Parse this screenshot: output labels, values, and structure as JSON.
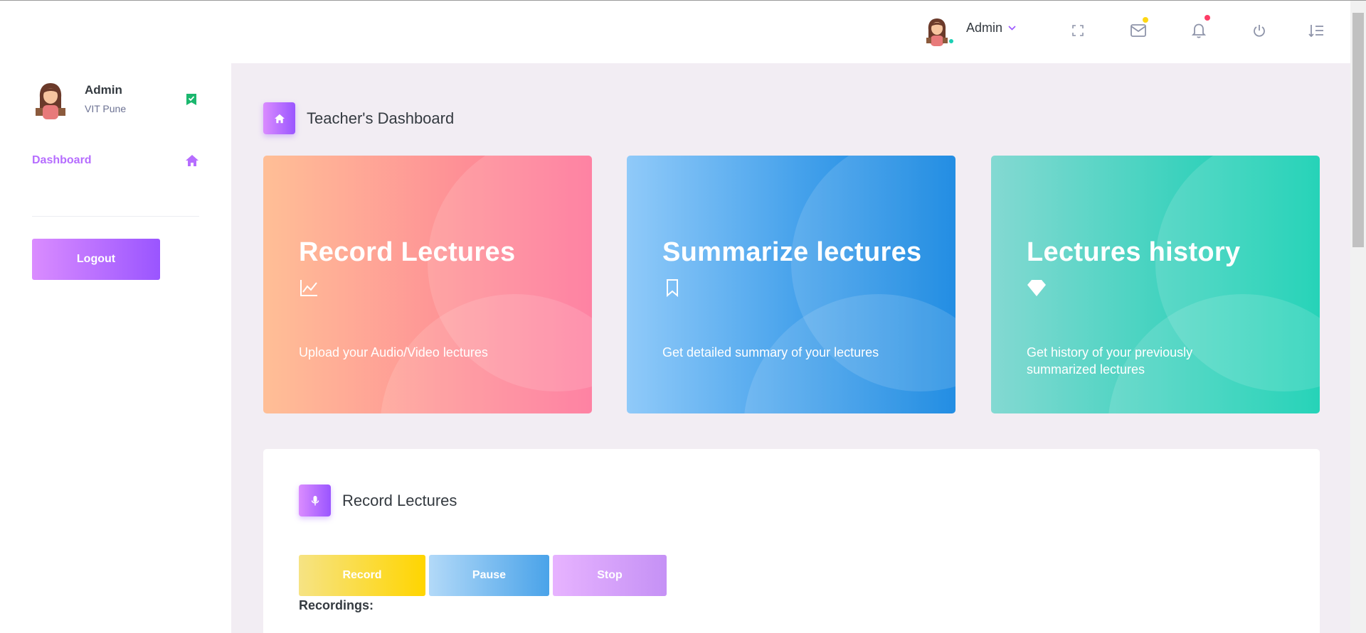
{
  "navbar": {
    "username": "Admin",
    "notification_badge_colors": {
      "mail": "#fed713",
      "bell": "#fe7c96"
    }
  },
  "sidebar": {
    "profile_name": "Admin",
    "profile_location": "VIT Pune",
    "dashboard_label": "Dashboard",
    "logout_label": "Logout"
  },
  "main": {
    "page_title": "Teacher's Dashboard",
    "cards": [
      {
        "title": "Record Lectures",
        "icon": "chart-line-icon",
        "description": "Upload your Audio/Video lectures"
      },
      {
        "title": "Summarize lectures",
        "icon": "bookmark-icon",
        "description": "Get detailed summary of your lectures"
      },
      {
        "title": "Lectures history",
        "icon": "diamond-icon",
        "description": "Get history of your previously summarized lectures"
      }
    ],
    "record_section": {
      "title": "Record Lectures",
      "record_label": "Record",
      "pause_label": "Pause",
      "stop_label": "Stop",
      "recordings_label": "Recordings:"
    }
  },
  "colors": {
    "accent": "#9a55ff",
    "accent_light": "#da8cff",
    "main_bg": "#f2edf3",
    "online_dot": "#1bcfb4"
  }
}
